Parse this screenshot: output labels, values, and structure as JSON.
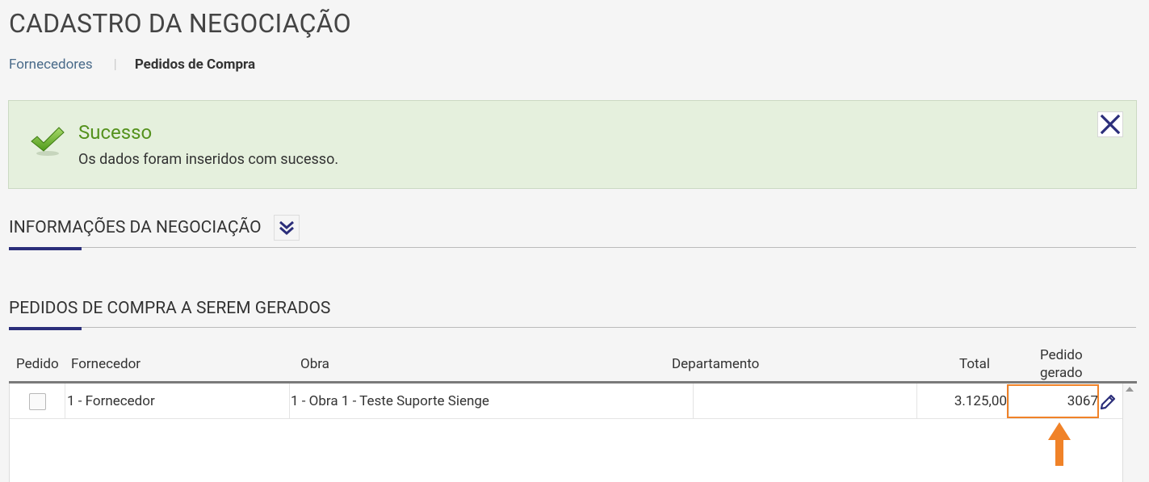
{
  "page": {
    "title": "CADASTRO DA NEGOCIAÇÃO"
  },
  "breadcrumb": {
    "link": "Fornecedores",
    "separator": "|",
    "active": "Pedidos de Compra"
  },
  "alert": {
    "title": "Sucesso",
    "message": "Os dados foram inseridos com sucesso.",
    "icon": "checkmark-icon",
    "close_icon": "close-icon"
  },
  "sections": {
    "info": {
      "title": "INFORMAÇÕES DA NEGOCIAÇÃO",
      "toggle_icon": "double-chevron-down-icon"
    },
    "orders": {
      "title": "PEDIDOS DE COMPRA A SEREM GERADOS"
    }
  },
  "grid": {
    "columns": {
      "pedido": "Pedido",
      "fornecedor": "Fornecedor",
      "obra": "Obra",
      "departamento": "Departamento",
      "total": "Total",
      "pedido_gerado_1": "Pedido",
      "pedido_gerado_2": "gerado"
    },
    "rows": [
      {
        "fornecedor": "1 - Fornecedor",
        "obra": "1 - Obra 1 - Teste Suporte Sienge",
        "departamento": "",
        "total": "3.125,00",
        "pedido_gerado": "3067",
        "checked": false
      }
    ],
    "edit_icon": "pencil-icon"
  },
  "colors": {
    "accent": "#2b2e7a",
    "success_bg": "#e5f0dd",
    "success_text": "#55921e",
    "highlight": "#f08228"
  }
}
